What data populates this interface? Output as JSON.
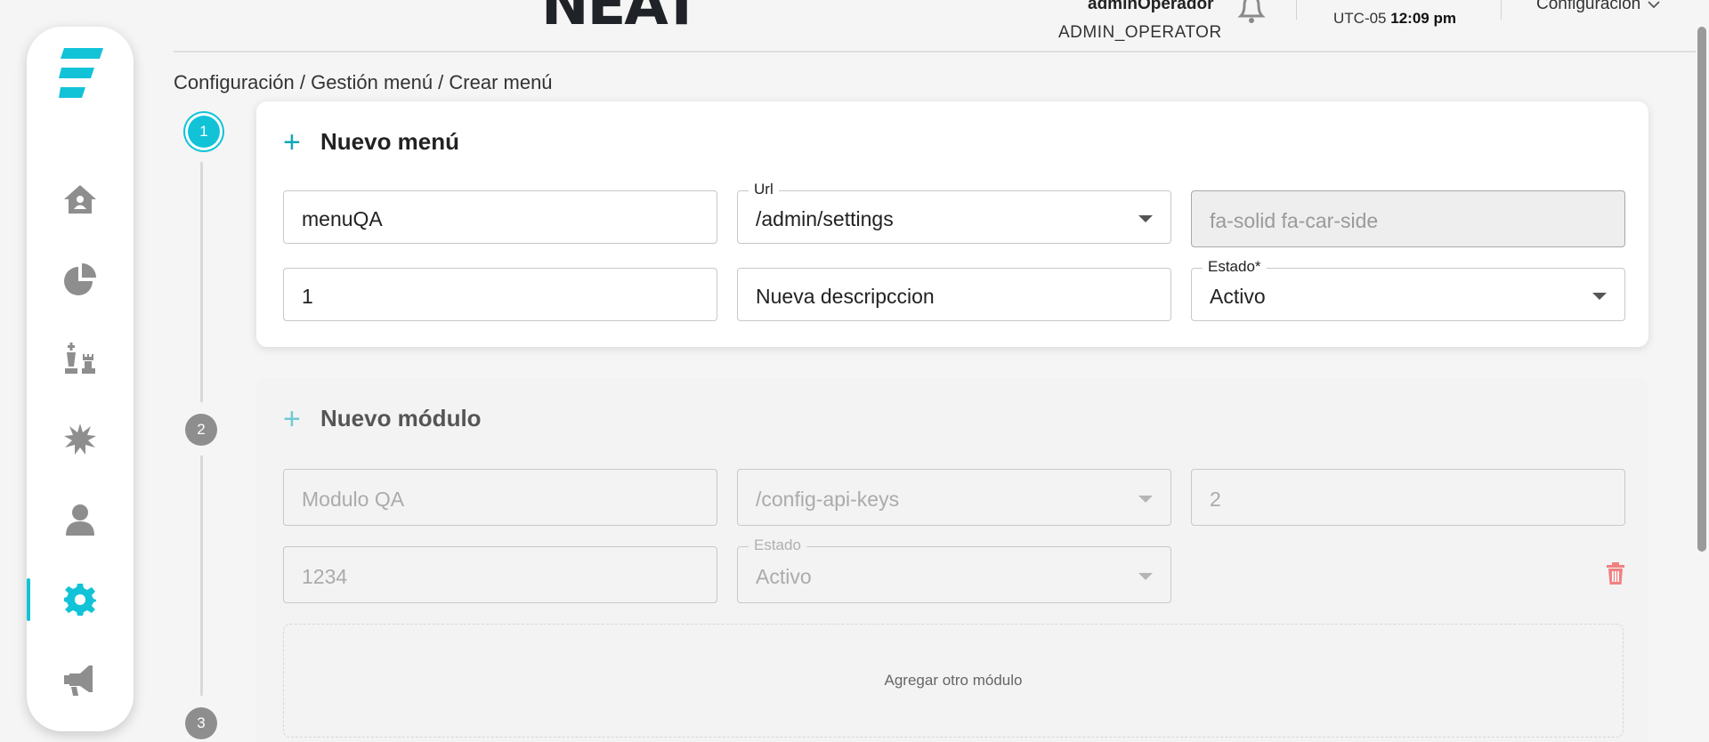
{
  "app": {
    "brand": "NEAT",
    "user_name": "adminOperador",
    "user_role": "ADMIN_OPERATOR",
    "timezone": "UTC-05",
    "time": "12:09 pm",
    "config_menu_label": "Configuración"
  },
  "sidebar": {
    "items": [
      {
        "icon": "home-icon"
      },
      {
        "icon": "pie-chart-icon"
      },
      {
        "icon": "chess-icon"
      },
      {
        "icon": "burst-icon"
      },
      {
        "icon": "user-icon"
      },
      {
        "icon": "gear-icon",
        "active": true
      },
      {
        "icon": "megaphone-icon"
      }
    ]
  },
  "breadcrumb": "Configuración / Gestión menú / Crear menú",
  "steps": [
    "1",
    "2",
    "3"
  ],
  "menu_card": {
    "title": "Nuevo menú",
    "name_value": "menuQA",
    "url_label": "Url",
    "url_value": "/admin/settings",
    "icon_value": "fa-solid fa-car-side",
    "order_value": "1",
    "description_value": "Nueva descripccion",
    "status_label": "Estado*",
    "status_value": "Activo"
  },
  "module_card": {
    "title": "Nuevo módulo",
    "name_value": "Modulo QA",
    "url_value": "/config-api-keys",
    "order_value": "2",
    "code_value": "1234",
    "status_label": "Estado",
    "status_value": "Activo",
    "add_label": "Agregar otro módulo"
  },
  "colors": {
    "accent": "#12c3d8",
    "danger": "#f08080",
    "brand_dark": "#1f2226"
  }
}
